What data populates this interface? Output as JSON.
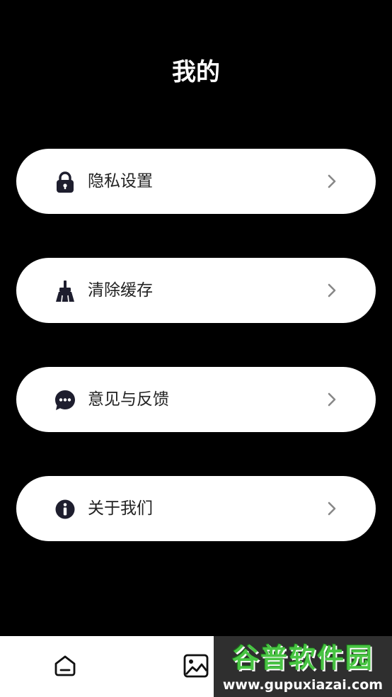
{
  "header": {
    "title": "我的"
  },
  "menu": {
    "items": [
      {
        "label": "隐私设置",
        "icon": "lock-icon"
      },
      {
        "label": "清除缓存",
        "icon": "broom-icon"
      },
      {
        "label": "意见与反馈",
        "icon": "chat-bubble-icon"
      },
      {
        "label": "关于我们",
        "icon": "info-icon"
      }
    ]
  },
  "bottom_nav": {
    "items": [
      {
        "icon": "home-icon"
      },
      {
        "icon": "image-icon"
      }
    ]
  },
  "watermark": {
    "text": "谷普软件园",
    "url": "www.gupuxiazai.com"
  },
  "colors": {
    "background": "#000000",
    "card": "#ffffff",
    "icon": "#1e1e2e",
    "arrow": "#888888",
    "watermark_green": "#48c443"
  }
}
